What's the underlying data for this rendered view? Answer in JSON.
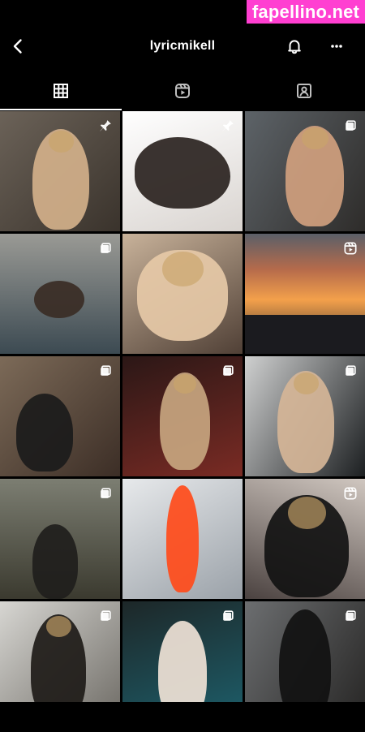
{
  "watermark": {
    "text": "fapellino.net"
  },
  "header": {
    "title": "lyricmikell",
    "back_icon": "chevron-left-icon",
    "notifications_icon": "bell-icon",
    "more_icon": "more-horizontal-icon"
  },
  "tabs": [
    {
      "id": "posts",
      "icon": "grid-icon",
      "active": true
    },
    {
      "id": "reels",
      "icon": "reels-icon",
      "active": false
    },
    {
      "id": "tagged",
      "icon": "tagged-icon",
      "active": false
    }
  ],
  "grid": {
    "tiles": [
      {
        "badge": "pin-icon",
        "bg1": "#6b6258",
        "bg2": "#3a332c",
        "fig": "#d3b08a"
      },
      {
        "badge": "pin-icon",
        "bg1": "#ffffff",
        "bg2": "#d9d4d0",
        "fig": "#2a2320"
      },
      {
        "badge": "carousel-icon",
        "bg1": "#5d6368",
        "bg2": "#2e2c2a",
        "fig": "#d0a07e"
      },
      {
        "badge": "carousel-icon",
        "bg1": "#9a9a95",
        "bg2": "#3c4a52",
        "fig": "#3a2c25"
      },
      {
        "badge": "",
        "bg1": "#c8b29a",
        "bg2": "#504036",
        "fig": "#e6c9a7"
      },
      {
        "badge": "reels-icon",
        "bg1": "#7a5c4b",
        "bg2": "#f4a35c",
        "fig": "#1c1b21"
      },
      {
        "badge": "carousel-icon",
        "bg1": "#7c6a58",
        "bg2": "#3c2e26",
        "fig": "#1b1b1b"
      },
      {
        "badge": "carousel-icon",
        "bg1": "#2b1716",
        "bg2": "#7a2b24",
        "fig": "#c7a57f"
      },
      {
        "badge": "carousel-icon",
        "bg1": "#cfd0d0",
        "bg2": "#1c1f21",
        "fig": "#d5b597"
      },
      {
        "badge": "carousel-icon",
        "bg1": "#7c7e72",
        "bg2": "#3b3a2f",
        "fig": "#1f1e1c"
      },
      {
        "badge": "",
        "bg1": "#e7e9eb",
        "bg2": "#9aa1a8",
        "fig": "#ff4b1a"
      },
      {
        "badge": "reels-icon",
        "bg1": "#d0c7c0",
        "bg2": "#4b4240",
        "fig": "#121212"
      },
      {
        "badge": "carousel-icon",
        "bg1": "#d7d6d2",
        "bg2": "#6f6c66",
        "fig": "#1e1b18"
      },
      {
        "badge": "carousel-icon",
        "bg1": "#1d2728",
        "bg2": "#1d5e6a",
        "fig": "#efe2d6"
      },
      {
        "badge": "carousel-icon",
        "bg1": "#6c6e70",
        "bg2": "#272625",
        "fig": "#111111"
      }
    ]
  },
  "colors": {
    "background": "#000000",
    "accent_watermark": "#ff3fd1",
    "icon": "#ffffff"
  }
}
